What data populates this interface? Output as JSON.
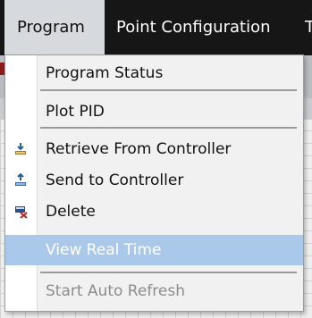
{
  "menubar": {
    "items": [
      {
        "label": "Program"
      },
      {
        "label": "Point Configuration"
      },
      {
        "label": "T"
      }
    ]
  },
  "program_menu": {
    "items": [
      {
        "label": "Program Status",
        "icon": null,
        "enabled": true
      },
      {
        "label": "Plot PID",
        "icon": null,
        "enabled": true
      },
      {
        "label": "Retrieve From Controller",
        "icon": "retrieve-icon",
        "enabled": true
      },
      {
        "label": "Send to Controller",
        "icon": "send-icon",
        "enabled": true
      },
      {
        "label": "Delete",
        "icon": "delete-icon",
        "enabled": true
      },
      {
        "label": "View Real Time",
        "icon": null,
        "enabled": false,
        "highlighted": true
      },
      {
        "label": "Start Auto Refresh",
        "icon": null,
        "enabled": false
      }
    ]
  },
  "colors": {
    "menubar_bg": "#161616",
    "open_menu_bg": "#d6d9dd",
    "menu_bg": "#f1f1f1",
    "highlight_bg": "#aac8ea",
    "disabled_text": "#8c8c8c"
  }
}
